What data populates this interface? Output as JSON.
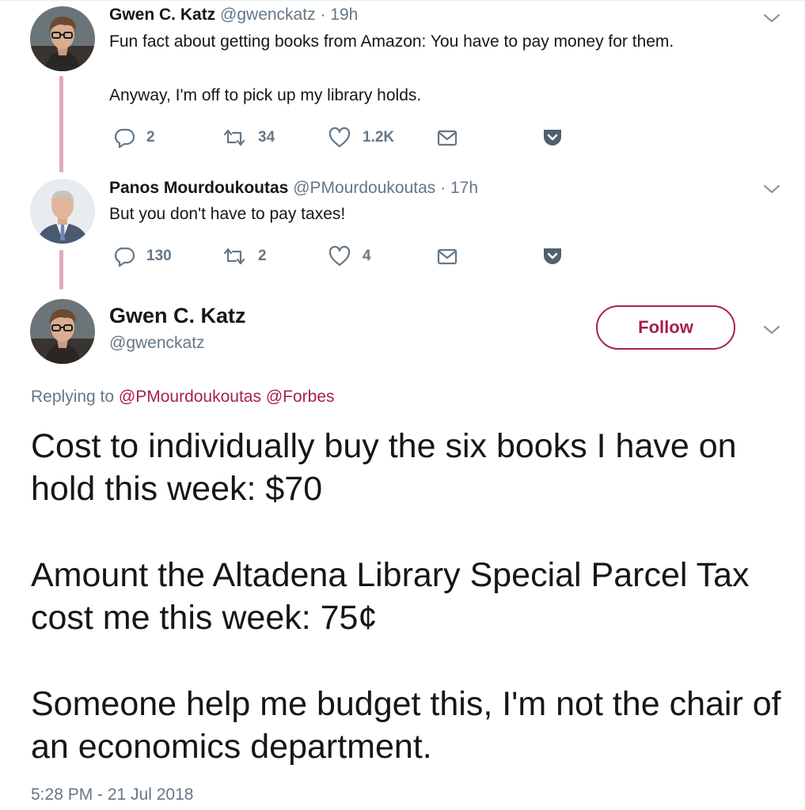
{
  "tweets": [
    {
      "name": "Gwen C. Katz",
      "handle": "@gwenckatz",
      "dot": "·",
      "time": "19h",
      "text": "Fun fact about getting books from Amazon: You have to pay money for them.\n\nAnyway, I'm off to pick up my library holds.",
      "replies": "2",
      "retweets": "34",
      "likes": "1.2K"
    },
    {
      "name": "Panos Mourdoukoutas",
      "handle": "@PMourdoukoutas",
      "dot": "·",
      "time": "17h",
      "text": "But you don't have to pay taxes!",
      "replies": "130",
      "retweets": "2",
      "likes": "4"
    }
  ],
  "main_tweet": {
    "name": "Gwen C. Katz",
    "handle": "@gwenckatz",
    "follow_label": "Follow",
    "replying_prefix": "Replying to",
    "replying_to": [
      "@PMourdoukoutas",
      "@Forbes"
    ],
    "paragraphs": [
      "Cost to individually buy the six books I have on hold this week: $70",
      "Amount the Altadena Library Special Parcel Tax cost me this week: 75¢",
      "Someone help me budget this, I'm not the chair of an economics department."
    ],
    "timestamp": "5:28 PM - 21 Jul 2018"
  },
  "colors": {
    "accent": "#a8204b",
    "thread_line": "#e2a8bd",
    "secondary_text": "#657786",
    "primary_text": "#14171a"
  },
  "icons": [
    "reply-icon",
    "retweet-icon",
    "like-icon",
    "direct-message-icon",
    "pocket-icon",
    "chevron-down-icon"
  ]
}
